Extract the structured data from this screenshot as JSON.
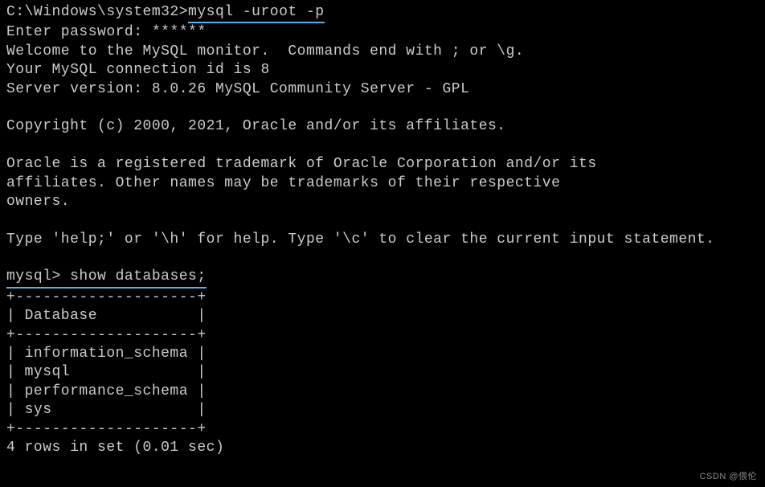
{
  "prompt1": {
    "path": "C:\\Windows\\system32>",
    "command": "mysql -uroot -p"
  },
  "enter_password": "Enter password: ******",
  "welcome1": "Welcome to the MySQL monitor.  Commands end with ; or \\g.",
  "welcome2": "Your MySQL connection id is 8",
  "welcome3": "Server version: 8.0.26 MySQL Community Server - GPL",
  "copyright": "Copyright (c) 2000, 2021, Oracle and/or its affiliates.",
  "trademark1": "Oracle is a registered trademark of Oracle Corporation and/or its",
  "trademark2": "affiliates. Other names may be trademarks of their respective",
  "trademark3": "owners.",
  "help_line": "Type 'help;' or '\\h' for help. Type '\\c' to clear the current input statement.",
  "prompt2": {
    "path": "mysql> ",
    "command": "show databases;"
  },
  "table_border": "+--------------------+",
  "table_header": "| Database           |",
  "table_row1": "| information_schema |",
  "table_row2": "| mysql              |",
  "table_row3": "| performance_schema |",
  "table_row4": "| sys                |",
  "result_summary": "4 rows in set (0.01 sec)",
  "watermark": "CSDN @偎伦",
  "chart_data": {
    "type": "table",
    "title": "Database",
    "rows": [
      "information_schema",
      "mysql",
      "performance_schema",
      "sys"
    ],
    "row_count": 4,
    "query_time_sec": 0.01
  }
}
